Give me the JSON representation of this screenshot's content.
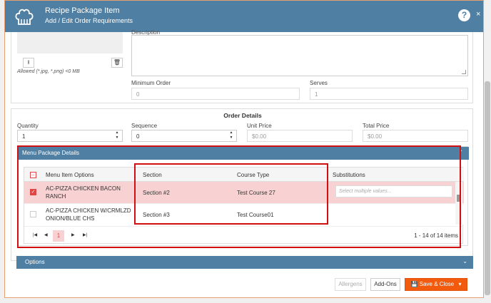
{
  "header": {
    "title": "Recipe Package Item",
    "subtitle": "Add / Edit Order Requirements",
    "help": "?",
    "close": "×"
  },
  "image": {
    "allowed_text": "Allowed (*.jpg, *.png) <0 MB",
    "upload_icon": "upload-icon",
    "delete_icon": "trash-icon"
  },
  "description": {
    "label": "Description",
    "value": ""
  },
  "min_order": {
    "label": "Minimum Order",
    "value": "0"
  },
  "serves": {
    "label": "Serves",
    "value": "1"
  },
  "order_details": {
    "title": "Order Details",
    "quantity": {
      "label": "Quantity",
      "value": "1"
    },
    "sequence": {
      "label": "Sequence",
      "value": "0"
    },
    "unit_price": {
      "label": "Unit Price",
      "value": "$0.00"
    },
    "total_price": {
      "label": "Total Price",
      "value": "$0.00"
    }
  },
  "menu_package": {
    "title": "Menu Package Details",
    "columns": [
      "Menu Item Options",
      "Section",
      "Course Type",
      "Substitutions"
    ],
    "rows": [
      {
        "checked": true,
        "item": "AC-PIZZA CHICKEN BACON RANCH",
        "section": "Section #2",
        "course": "Test Course 27",
        "substitutions_placeholder": "Select multiple values..."
      },
      {
        "checked": false,
        "item": "AC-PIZZA CHICKEN W/CRMLZD ONION/BLUE CHS",
        "section": "Section #3",
        "course": "Test Course01",
        "substitutions_placeholder": ""
      }
    ],
    "pager": {
      "current": "1",
      "count": "1 - 14 of 14 items"
    }
  },
  "options": {
    "title": "Options"
  },
  "footer": {
    "allergens": "Allergens",
    "addons": "Add-Ons",
    "save": "Save & Close"
  },
  "colors": {
    "header": "#4f7fa2",
    "accent": "#f25a0d",
    "selected_row": "#f8d2d2",
    "highlight": "#d01010"
  }
}
